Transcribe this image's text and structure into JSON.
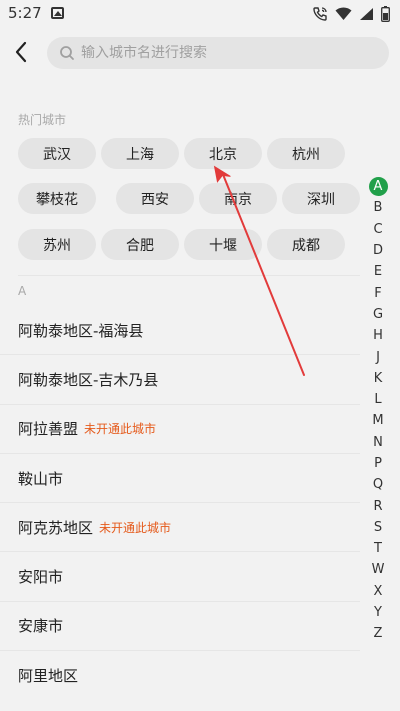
{
  "status_bar": {
    "time": "5:27"
  },
  "search": {
    "placeholder": "输入城市名进行搜索",
    "value": ""
  },
  "hot_cities": {
    "title": "热门城市",
    "items": [
      "武汉",
      "上海",
      "北京",
      "杭州",
      "攀枝花",
      "西安",
      "南京",
      "深圳",
      "苏州",
      "合肥",
      "十堰",
      "成都"
    ]
  },
  "list": {
    "letter_header": "A",
    "cities": [
      {
        "name": "阿勒泰地区-福海县",
        "tag": ""
      },
      {
        "name": "阿勒泰地区-吉木乃县",
        "tag": ""
      },
      {
        "name": "阿拉善盟",
        "tag": "未开通此城市"
      },
      {
        "name": "鞍山市",
        "tag": ""
      },
      {
        "name": "阿克苏地区",
        "tag": "未开通此城市"
      },
      {
        "name": "安阳市",
        "tag": ""
      },
      {
        "name": "安康市",
        "tag": ""
      },
      {
        "name": "阿里地区",
        "tag": ""
      }
    ]
  },
  "index_bar": {
    "letters": [
      "A",
      "B",
      "C",
      "D",
      "E",
      "F",
      "G",
      "H",
      "J",
      "K",
      "L",
      "M",
      "N",
      "P",
      "Q",
      "R",
      "S",
      "T",
      "W",
      "X",
      "Y",
      "Z"
    ],
    "active": "A"
  },
  "colors": {
    "accent_green": "#21a04a",
    "tag_orange": "#e55a1b",
    "annotation_red": "#e23b3b"
  },
  "icons": {
    "status_left": "image-icon",
    "status_right": [
      "call-wifi-icon",
      "wifi-icon",
      "signal-icon",
      "battery-icon"
    ],
    "back": "back-arrow-icon",
    "search": "search-icon"
  }
}
